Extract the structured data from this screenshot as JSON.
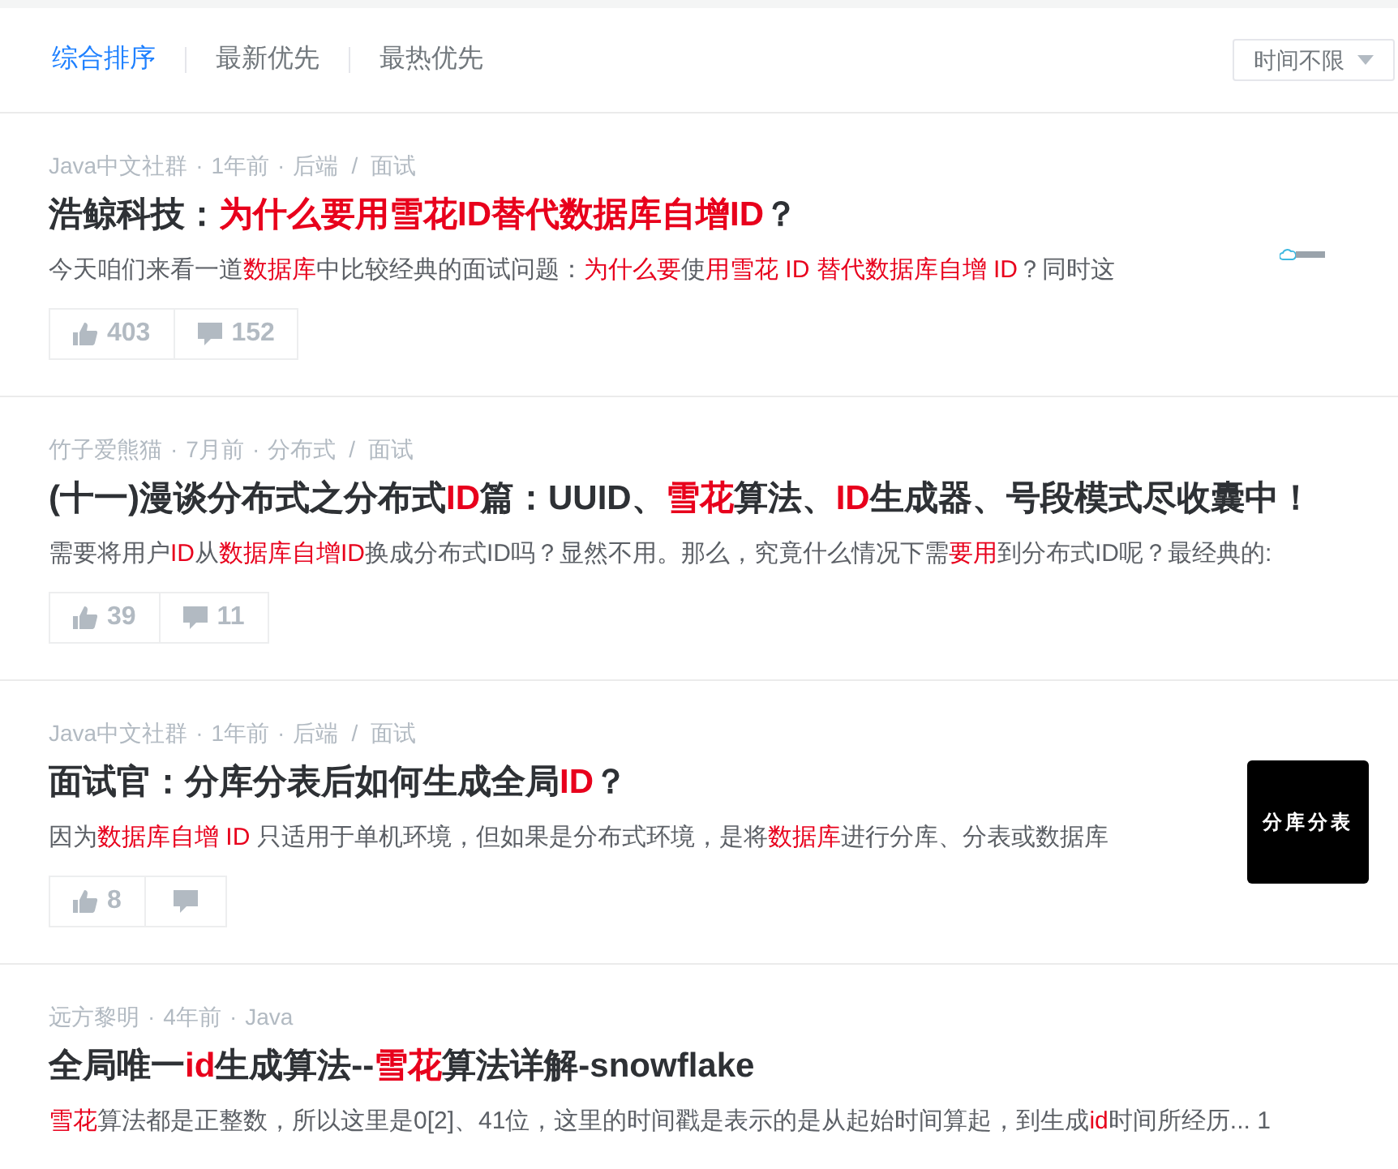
{
  "sort_tabs": [
    {
      "label": "综合排序",
      "selected": true
    },
    {
      "label": "最新优先",
      "selected": false
    },
    {
      "label": "最热优先",
      "selected": false
    }
  ],
  "time_filter": {
    "value": "时间不限"
  },
  "articles": [
    {
      "meta": [
        {
          "kind": "author",
          "text": "Java中文社群"
        },
        {
          "kind": "dot",
          "text": "·"
        },
        {
          "kind": "time",
          "text": "1年前"
        },
        {
          "kind": "dot",
          "text": "·"
        },
        {
          "kind": "category",
          "text": "后端"
        },
        {
          "kind": "slash",
          "text": "/"
        },
        {
          "kind": "tag",
          "text": "面试"
        }
      ],
      "title": [
        {
          "text": "浩鲸科技：",
          "hl": false
        },
        {
          "text": "为什么要用雪花ID替代数据库自增ID",
          "hl": true
        },
        {
          "text": "？",
          "hl": false
        }
      ],
      "snippet": [
        {
          "text": "今天咱们来看一道",
          "hl": false
        },
        {
          "text": "数据库",
          "hl": true
        },
        {
          "text": "中比较经典的面试问题：",
          "hl": false
        },
        {
          "text": "为什么要",
          "hl": true
        },
        {
          "text": "使",
          "hl": false
        },
        {
          "text": "用雪花 ID 替代数据库自增 ID",
          "hl": true
        },
        {
          "text": "？同时这",
          "hl": false
        }
      ],
      "likes": "403",
      "comments": "152",
      "thumbnail": {
        "kind": "logo"
      }
    },
    {
      "meta": [
        {
          "kind": "author",
          "text": "竹子爱熊猫"
        },
        {
          "kind": "dot",
          "text": "·"
        },
        {
          "kind": "time",
          "text": "7月前"
        },
        {
          "kind": "dot",
          "text": "·"
        },
        {
          "kind": "category",
          "text": "分布式"
        },
        {
          "kind": "slash",
          "text": "/"
        },
        {
          "kind": "tag",
          "text": "面试"
        }
      ],
      "title": [
        {
          "text": "(十一)漫谈分布式之分布式",
          "hl": false
        },
        {
          "text": "ID",
          "hl": true
        },
        {
          "text": "篇：UUID、",
          "hl": false
        },
        {
          "text": "雪花",
          "hl": true
        },
        {
          "text": "算法、",
          "hl": false
        },
        {
          "text": "ID",
          "hl": true
        },
        {
          "text": "生成器、号段模式尽收囊中！",
          "hl": false
        }
      ],
      "snippet": [
        {
          "text": "需要将用户",
          "hl": false
        },
        {
          "text": "ID",
          "hl": true
        },
        {
          "text": "从",
          "hl": false
        },
        {
          "text": "数据库自增ID",
          "hl": true
        },
        {
          "text": "换成分布式ID吗？显然不用。那么，究竟什么情况下需",
          "hl": false
        },
        {
          "text": "要用",
          "hl": true
        },
        {
          "text": "到分布式ID呢？最经典的:",
          "hl": false
        }
      ],
      "likes": "39",
      "comments": "11"
    },
    {
      "meta": [
        {
          "kind": "author",
          "text": "Java中文社群"
        },
        {
          "kind": "dot",
          "text": "·"
        },
        {
          "kind": "time",
          "text": "1年前"
        },
        {
          "kind": "dot",
          "text": "·"
        },
        {
          "kind": "category",
          "text": "后端"
        },
        {
          "kind": "slash",
          "text": "/"
        },
        {
          "kind": "tag",
          "text": "面试"
        }
      ],
      "title": [
        {
          "text": "面试官：分库分表后如何生成全局",
          "hl": false
        },
        {
          "text": "ID",
          "hl": true
        },
        {
          "text": "？",
          "hl": false
        }
      ],
      "snippet": [
        {
          "text": "因为",
          "hl": false
        },
        {
          "text": "数据库自增 ID",
          "hl": true
        },
        {
          "text": " 只适用于单机环境，但如果是分布式环境，是将",
          "hl": false
        },
        {
          "text": "数据库",
          "hl": true
        },
        {
          "text": "进行分库、分表或数据库",
          "hl": false
        }
      ],
      "likes": "8",
      "thumbnail": {
        "kind": "text",
        "text": "分库分表"
      }
    },
    {
      "meta": [
        {
          "kind": "author",
          "text": "远方黎明"
        },
        {
          "kind": "dot",
          "text": "·"
        },
        {
          "kind": "time",
          "text": "4年前"
        },
        {
          "kind": "dot",
          "text": "·"
        },
        {
          "kind": "category",
          "text": "Java"
        }
      ],
      "title": [
        {
          "text": "全局唯一",
          "hl": false
        },
        {
          "text": "id",
          "hl": true
        },
        {
          "text": "生成算法--",
          "hl": false
        },
        {
          "text": "雪花",
          "hl": true
        },
        {
          "text": "算法详解-snowflake",
          "hl": false
        }
      ],
      "snippet": [
        {
          "text": "雪花",
          "hl": true
        },
        {
          "text": "算法都是正整数，所以这里是0[2]、41位，这里的时间戳是表示的是从起始时间算起，到生成",
          "hl": false
        },
        {
          "text": "id",
          "hl": true
        },
        {
          "text": "时间所经历... 1",
          "hl": false
        }
      ]
    }
  ]
}
